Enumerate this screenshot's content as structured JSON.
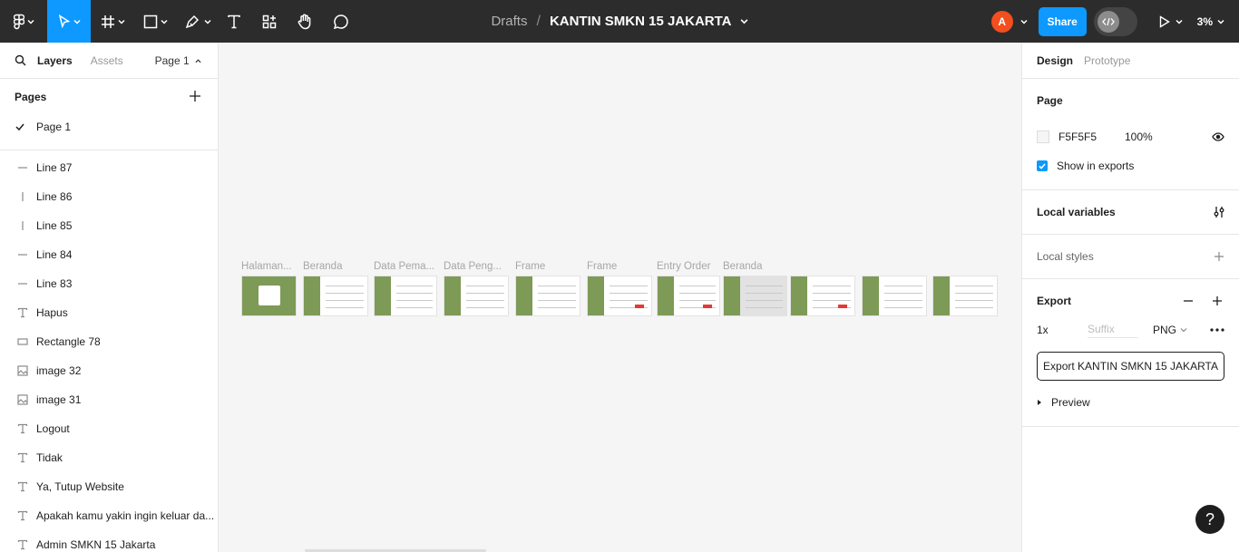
{
  "topbar": {
    "breadcrumb_root": "Drafts",
    "separator": "/",
    "file_name": "KANTIN SMKN 15 JAKARTA",
    "avatar_initial": "A",
    "share_label": "Share",
    "zoom": "3%",
    "accent": "#0d99ff",
    "avatar_color": "#f24e1e"
  },
  "left": {
    "tab_layers": "Layers",
    "tab_assets": "Assets",
    "current_page": "Page 1",
    "pages_heading": "Pages",
    "pages": [
      {
        "label": "Page 1"
      }
    ],
    "layers": [
      {
        "icon": "line-icon",
        "label": "Line 87"
      },
      {
        "icon": "vertical-line-icon",
        "label": "Line 86"
      },
      {
        "icon": "vertical-line-icon",
        "label": "Line 85"
      },
      {
        "icon": "line-icon",
        "label": "Line 84"
      },
      {
        "icon": "line-icon",
        "label": "Line 83"
      },
      {
        "icon": "text-icon",
        "label": "Hapus"
      },
      {
        "icon": "rectangle-icon",
        "label": "Rectangle 78"
      },
      {
        "icon": "image-icon",
        "label": "image 32"
      },
      {
        "icon": "image-icon",
        "label": "image 31"
      },
      {
        "icon": "text-icon",
        "label": "Logout"
      },
      {
        "icon": "text-icon",
        "label": "Tidak"
      },
      {
        "icon": "text-icon",
        "label": "Ya, Tutup Website"
      },
      {
        "icon": "text-icon",
        "label": "Apakah kamu yakin ingin keluar da..."
      },
      {
        "icon": "text-icon",
        "label": "Admin SMKN 15 Jakarta"
      }
    ]
  },
  "canvas": {
    "background": "#F5F5F5",
    "frames": [
      {
        "label": "Halaman..."
      },
      {
        "label": "Beranda"
      },
      {
        "label": "Data Pema..."
      },
      {
        "label": "Data Peng..."
      },
      {
        "label": "Frame"
      },
      {
        "label": "Frame"
      },
      {
        "label": "Entry Order"
      },
      {
        "label": "Beranda"
      },
      {
        "label": ""
      },
      {
        "label": ""
      },
      {
        "label": ""
      }
    ]
  },
  "right": {
    "tab_design": "Design",
    "tab_prototype": "Prototype",
    "page_heading": "Page",
    "page_color": "F5F5F5",
    "page_opacity": "100%",
    "show_in_exports": "Show in exports",
    "local_variables": "Local variables",
    "local_styles": "Local styles",
    "export_heading": "Export",
    "export_scale": "1x",
    "suffix_placeholder": "Suffix",
    "export_format": "PNG",
    "export_button": "Export KANTIN SMKN 15 JAKARTA",
    "preview": "Preview",
    "help": "?"
  }
}
